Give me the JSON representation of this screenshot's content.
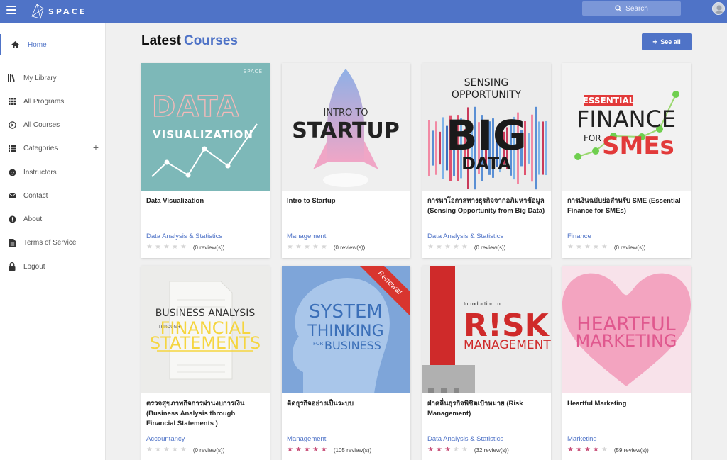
{
  "header": {
    "logo_text": "SPACE",
    "search_label": "Search"
  },
  "sidebar": {
    "items": [
      {
        "label": "Home",
        "icon": "home-icon"
      },
      {
        "label": "My Library",
        "icon": "library-icon"
      },
      {
        "label": "All Programs",
        "icon": "grid-icon"
      },
      {
        "label": "All Courses",
        "icon": "play-circle-icon"
      },
      {
        "label": "Categories",
        "icon": "list-icon"
      },
      {
        "label": "Instructors",
        "icon": "instructor-icon"
      },
      {
        "label": "Contact",
        "icon": "mail-icon"
      },
      {
        "label": "About",
        "icon": "info-icon"
      },
      {
        "label": "Terms of Service",
        "icon": "document-icon"
      },
      {
        "label": "Logout",
        "icon": "lock-icon"
      }
    ],
    "categories_plus": "+"
  },
  "main": {
    "heading_main": "Latest",
    "heading_accent": "Courses",
    "see_all": "See all",
    "see_all_plus": "+"
  },
  "courses": [
    {
      "title": "Data Visualization",
      "category": "Data Analysis & Statistics",
      "rating": 0,
      "reviews": "(0 review(s))",
      "cover": {
        "line1": "DATA",
        "line2": "VISUALIZATION",
        "brand": "SPACE"
      }
    },
    {
      "title": "Intro to Startup",
      "category": "Management",
      "rating": 0,
      "reviews": "(0 review(s))",
      "cover": {
        "line1": "INTRO TO",
        "line2": "STARTUP"
      }
    },
    {
      "title": "การหาโอกาสทางธุรกิจจากอภิมหาข้อมูล (Sensing Opportunity from Big Data)",
      "category": "Data Analysis & Statistics",
      "rating": 0,
      "reviews": "(0 review(s))",
      "cover": {
        "line1": "SENSING",
        "line2": "OPPORTUNITY",
        "line3": "BIG",
        "line4": "DATA"
      }
    },
    {
      "title": "การเงินฉบับย่อสำหรับ SME (Essential Finance for SMEs)",
      "category": "Finance",
      "rating": 0,
      "reviews": "(0 review(s))",
      "cover": {
        "line1": "ESSENTIAL",
        "line2": "FINANCE",
        "line3": "FOR",
        "line4": "SMEs"
      }
    },
    {
      "title": "ตรวจสุขภาพกิจการผ่านงบการเงิน (Business Analysis through Financial Statements )",
      "category": "Accountancy",
      "rating": 0,
      "reviews": "(0 review(s))",
      "cover": {
        "line1": "BUSINESS ANALYSIS",
        "line2": "THROUGH",
        "line3": "FINANCIAL",
        "line4": "STATEMENTS"
      }
    },
    {
      "title": "คิดธุรกิจอย่างเป็นระบบ",
      "category": "Management",
      "rating": 5,
      "reviews": "(105 review(s))",
      "cover": {
        "line1": "SYSTEM",
        "line2": "THINKING",
        "line3": "FOR",
        "line4": "BUSINESS",
        "ribbon": "Renewal"
      }
    },
    {
      "title": "ฝ่าคลื่นธุรกิจพิชิตเป้าหมาย (Risk Management)",
      "category": "Data Analysis & Statistics",
      "rating": 3,
      "reviews": "(32 review(s))",
      "cover": {
        "line1": "Introduction to",
        "line2": "R!SK",
        "line3": "MANAGEMENT"
      }
    },
    {
      "title": "Heartful Marketing",
      "category": "Marketing",
      "rating": 4,
      "reviews": "(59 review(s))",
      "cover": {
        "line1": "HEARTFUL",
        "line2": "MARKETING"
      }
    }
  ],
  "colors": {
    "brand": "#4f73c7",
    "star_on": "#c9517a",
    "star_off": "#d6d6d6"
  }
}
